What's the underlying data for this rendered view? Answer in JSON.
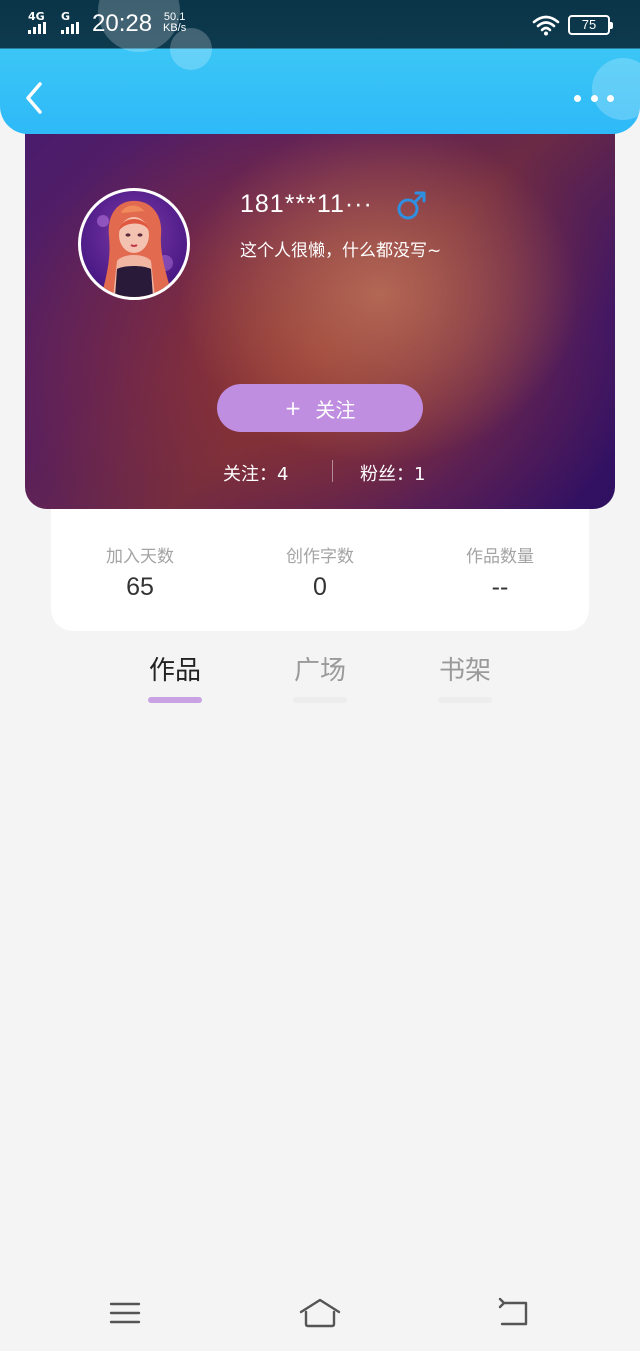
{
  "status_bar": {
    "network_1": "4G",
    "network_2": "G",
    "time": "20:28",
    "speed_value": "50.1",
    "speed_unit": "KB/s",
    "battery": "75",
    "wifi_icon": "wifi-icon"
  },
  "header": {
    "back_icon": "chevron-left-icon",
    "more_icon": "more-dots-icon"
  },
  "profile": {
    "username": "181***11···",
    "gender_icon": "male-symbol-icon",
    "gender_color": "#2f8fe0",
    "bio": "这个人很懒，什么都没写~",
    "follow_button": {
      "icon": "+",
      "label": "关注"
    },
    "following_text": "关注：4",
    "fans_text": "粉丝：1"
  },
  "stats": [
    {
      "label": "加入天数",
      "value": "65"
    },
    {
      "label": "创作字数",
      "value": "0"
    },
    {
      "label": "作品数量",
      "value": "--"
    }
  ],
  "tabs": [
    {
      "label": "作品",
      "active": true
    },
    {
      "label": "广场",
      "active": false
    },
    {
      "label": "书架",
      "active": false
    }
  ],
  "bottom_nav": {
    "menu_icon": "menu-icon",
    "home_icon": "home-icon",
    "back_icon": "back-arrow-icon"
  },
  "colors": {
    "header_gradient_top": "#3bc6f6",
    "header_gradient_bottom": "#2eb9f8",
    "follow_button": "#bf8ee0",
    "active_tab_indicator": "#c9a2e4",
    "page_background": "#f4f4f4"
  }
}
